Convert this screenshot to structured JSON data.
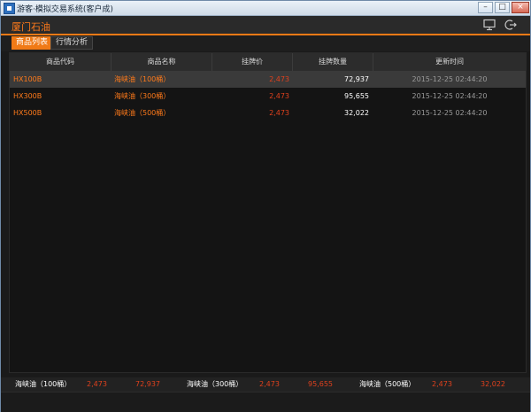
{
  "window": {
    "title": "游客·模拟交易系统(客户成)"
  },
  "header": {
    "brand": "厦门石油"
  },
  "tabs": [
    {
      "label": "商品列表",
      "active": true
    },
    {
      "label": "行情分析",
      "active": false
    }
  ],
  "table": {
    "columns": [
      "商品代码",
      "商品名称",
      "挂牌价",
      "挂牌数量",
      "更新时间"
    ],
    "rows": [
      {
        "code": "HX100B",
        "name": "海峡油（100桶）",
        "price": "2,473",
        "qty": "72,937",
        "time": "2015-12-25 02:44:20",
        "selected": true
      },
      {
        "code": "HX300B",
        "name": "海峡油（300桶）",
        "price": "2,473",
        "qty": "95,655",
        "time": "2015-12-25 02:44:20",
        "selected": false
      },
      {
        "code": "HX500B",
        "name": "海峡油（500桶）",
        "price": "2,473",
        "qty": "32,022",
        "time": "2015-12-25 02:44:20",
        "selected": false
      }
    ]
  },
  "ticker": [
    {
      "name": "海峡油（100桶）",
      "price": "2,473",
      "qty": "72,937"
    },
    {
      "name": "海峡油（300桶）",
      "price": "2,473",
      "qty": "95,655"
    },
    {
      "name": "海峡油（500桶）",
      "price": "2,473",
      "qty": "32,022"
    }
  ],
  "colors": {
    "accent": "#f07a16",
    "price_red": "#e0411d"
  },
  "icons": {
    "window_controls": [
      "minimize-icon",
      "maximize-icon",
      "close-icon"
    ],
    "header": [
      "monitor-icon",
      "logout-icon"
    ]
  }
}
